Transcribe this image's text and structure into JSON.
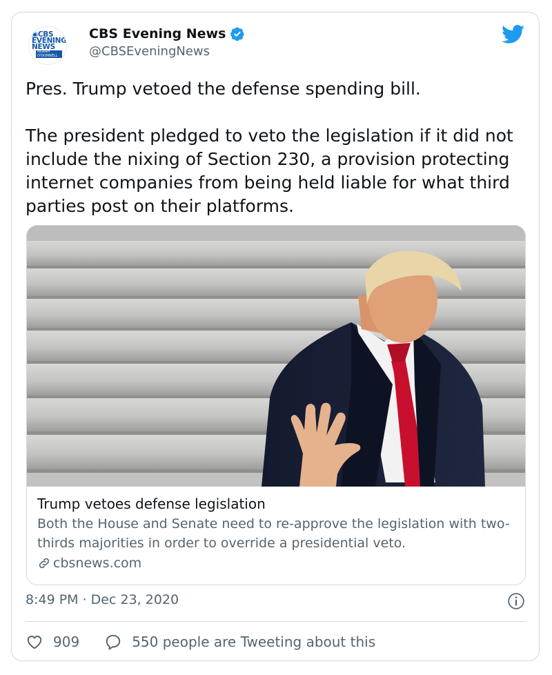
{
  "account": {
    "name": "CBS Evening News",
    "handle": "@CBSEveningNews",
    "avatar_logo": "CBS EVENING NEWS WITH NORAH O'DONNELL"
  },
  "tweet": {
    "text": "Pres. Trump vetoed the defense spending bill.\n\nThe president pledged to veto the legislation if it did not include the nixing of Section 230, a provision protecting internet companies from being held liable for what third parties post on their platforms."
  },
  "link_card": {
    "title": "Trump vetoes defense legislation",
    "description": "Both the House and Senate need to re-approve the legislation with two-thirds majorities in order to override a presidential veto.",
    "domain": "cbsnews.com"
  },
  "meta": {
    "timestamp": "8:49 PM · Dec 23, 2020"
  },
  "actions": {
    "likes": "909",
    "tweeting": "550 people are Tweeting about this"
  },
  "colors": {
    "verified": "#1d9bf0",
    "twitter_blue": "#1d9bf0",
    "muted_text": "#536471",
    "border": "#cfd9de"
  },
  "icons": [
    "verified-badge-icon",
    "twitter-bird-icon",
    "link-icon",
    "info-icon",
    "heart-icon",
    "reply-bubble-icon"
  ]
}
